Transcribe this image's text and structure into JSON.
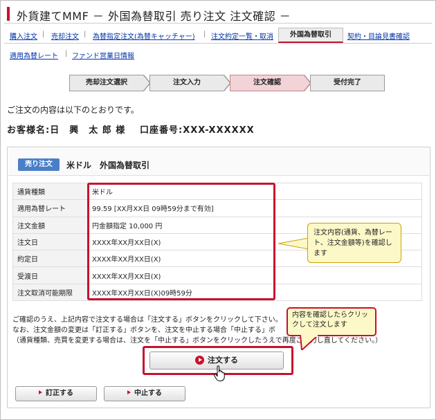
{
  "page_title": "外貨建てMMF － 外国為替取引 売り注文 注文確認 －",
  "nav_primary": [
    "購入注文",
    "売却注文",
    "為替指定注文(為替キャッチャー)",
    "注文約定一覧・取消"
  ],
  "nav_active": "外国為替取引",
  "nav_after_active": "契約・目論見書確認",
  "nav_secondary": [
    "適用為替レート",
    "ファンド営業日情報"
  ],
  "steps": [
    "売却注文選択",
    "注文入力",
    "注文確認",
    "受付完了"
  ],
  "current_step": "注文確認",
  "intro_text": "ご注文の内容は以下のとおりです。",
  "customer": {
    "name_line": "お客様名:日　興　太 郎 様",
    "account_line": "口座番号:XXX-XXXXXX"
  },
  "panel": {
    "badge": "売り注文",
    "title": "米ドル　外国為替取引"
  },
  "details": [
    {
      "label": "通貨種類",
      "value": "米ドル"
    },
    {
      "label": "適用為替レート",
      "value": "99.59 [XX月XX日 09時59分まで有効]"
    },
    {
      "label": "注文金額",
      "value": "円金額指定  10,000 円"
    },
    {
      "label": "注文日",
      "value": "XXXX年XX月XX日(X)"
    },
    {
      "label": "約定日",
      "value": "XXXX年XX月XX日(X)"
    },
    {
      "label": "受渡日",
      "value": "XXXX年XX月XX日(X)"
    },
    {
      "label": "注文取消可能期限",
      "value": "XXXX年XX月XX日(X)09時59分"
    }
  ],
  "callout_details": "注文内容(通貨、為替レート、注文金額等)を確認します",
  "callout_order": "内容を確認したらクリックして注文します",
  "instructions": [
    "ご確認のうえ、上記内容で注文する場合は「注文する」ボタンをクリックして下さい。",
    "なお、注文金額の変更は「訂正する」ボタンを、注文を中止する場合「中止する」ボ",
    "（通貨種類、売買を変更する場合は、注文を「中止する」ボタンをクリックしたうえで再度ご入力し直してください。）"
  ],
  "buttons": {
    "order": "注文する",
    "correct": "訂正する",
    "cancel": "中止する"
  },
  "colors": {
    "accent_red": "#c8102e",
    "badge_blue": "#4a7fc8",
    "callout_yellow": "#fdf8c8",
    "link_blue": "#0033aa"
  }
}
